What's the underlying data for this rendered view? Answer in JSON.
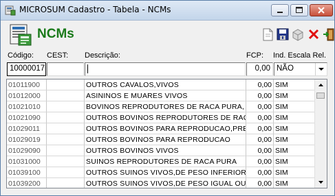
{
  "window": {
    "title": "MICROSUM Cadastro - Tabela - NCMs"
  },
  "header": {
    "form_title": "NCMs",
    "toolbar": [
      {
        "name": "new-document-icon"
      },
      {
        "name": "save-icon"
      },
      {
        "name": "delete-box-icon"
      },
      {
        "name": "cancel-x-icon"
      },
      {
        "name": "exit-door-icon"
      }
    ]
  },
  "labels": {
    "codigo": "Código:",
    "cest": "CEST:",
    "descricao": "Descrição:",
    "fcp": "FCP:",
    "ind_escala": "Ind. Escala Rel."
  },
  "inputs": {
    "codigo": "10000017",
    "cest": "",
    "descricao": "",
    "fcp": "0,00",
    "ind_escala": "NÃO"
  },
  "rows": [
    {
      "codigo": "01011900",
      "cest": "",
      "descricao": "OUTROS CAVALOS,VIVOS",
      "fcp": "0,00",
      "escala": "SIM"
    },
    {
      "codigo": "01012000",
      "cest": "",
      "descricao": "ASININOS E MUARES VIVOS",
      "fcp": "0,00",
      "escala": "SIM"
    },
    {
      "codigo": "01021010",
      "cest": "",
      "descricao": "BOVINOS REPRODUTORES DE RACA PURA,",
      "fcp": "0,00",
      "escala": "SIM"
    },
    {
      "codigo": "01021090",
      "cest": "",
      "descricao": "OUTROS BOVINOS REPRODUTORES DE RAÇ",
      "fcp": "0,00",
      "escala": "SIM"
    },
    {
      "codigo": "01029011",
      "cest": "",
      "descricao": "OUTROS BOVINOS PARA REPRODUCAO,PRE",
      "fcp": "0,00",
      "escala": "SIM"
    },
    {
      "codigo": "01029019",
      "cest": "",
      "descricao": "OUTROS BOVINOS PARA REPRODUCAO",
      "fcp": "0,00",
      "escala": "SIM"
    },
    {
      "codigo": "01029090",
      "cest": "",
      "descricao": "OUTROS BOVINOS VIVOS",
      "fcp": "0,00",
      "escala": "SIM"
    },
    {
      "codigo": "01031000",
      "cest": "",
      "descricao": "SUINOS REPRODUTORES DE RACA PURA",
      "fcp": "0,00",
      "escala": "SIM"
    },
    {
      "codigo": "01039100",
      "cest": "",
      "descricao": "OUTROS SUINOS VIVOS,DE PESO INFERIOR",
      "fcp": "0,00",
      "escala": "SIM"
    },
    {
      "codigo": "01039200",
      "cest": "",
      "descricao": "OUTROS SUINOS VIVOS,DE PESO IGUAL OU",
      "fcp": "0,00",
      "escala": "SIM"
    }
  ],
  "colors": {
    "form_title": "#1a7a1a",
    "close_button": "#c7503a"
  }
}
